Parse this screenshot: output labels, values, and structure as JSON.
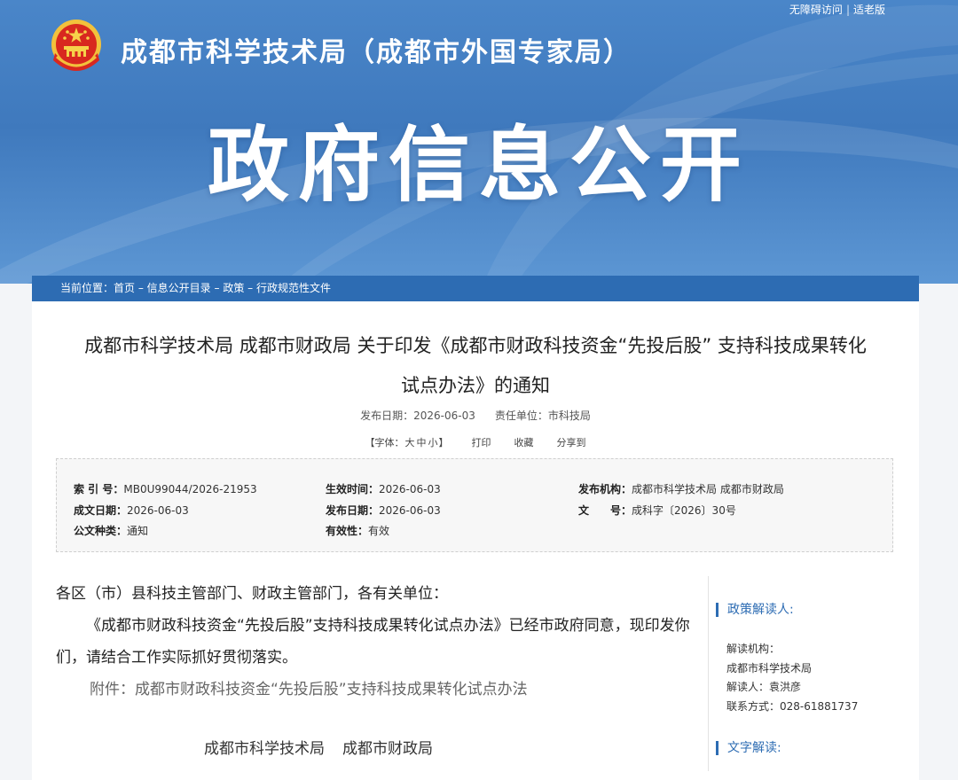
{
  "header": {
    "site_title": "成都市科学技术局（成都市外国专家局）",
    "hero_title": "政府信息公开",
    "top_links": [
      "无障碍访问",
      "适老版"
    ],
    "top_links_sep": "|"
  },
  "breadcrumb": {
    "prefix": "当前位置：",
    "items": [
      "首页",
      "信息公开目录",
      "政策",
      "行政规范性文件"
    ],
    "separator": " – "
  },
  "article": {
    "title_line1": "成都市科学技术局 成都市财政局 关于印发《成都市财政科技资金“先投后股” 支持科技成果转化",
    "title_line2": "试点办法》的通知",
    "publish_label": "发布日期：",
    "publish_date": "2026-06-03",
    "dept_label": "责任单位：",
    "dept": "市科技局"
  },
  "tools": {
    "font_label_open": "【字体：",
    "font_sizes": [
      "大",
      "中",
      "小"
    ],
    "font_label_close": "】",
    "print": "打印",
    "favorite": "收藏",
    "share": "分享到"
  },
  "info": {
    "index_label": "索 引 号：",
    "index_value": "MB0U99044/2026-21953",
    "effective_label": "生效时间：",
    "effective_value": "2026-06-03",
    "issuer_label": "发布机构：",
    "issuer_value": "成都市科学技术局 成都市财政局",
    "written_label": "成文日期：",
    "written_value": "2026-06-03",
    "publish_label": "发布日期：",
    "publish_value": "2026-06-03",
    "docno_label": "文　　号：",
    "docno_value": "成科字〔2026〕30号",
    "type_label": "公文种类：",
    "type_value": "通知",
    "validity_label": "有效性：",
    "validity_value": "有效"
  },
  "body": {
    "salutation": "各区（市）县科技主管部门、财政主管部门，各有关单位：",
    "paragraph": "《成都市财政科技资金“先投后股”支持科技成果转化试点办法》已经市政府同意，现印发你们，请结合工作实际抓好贯彻落实。",
    "attachment_label": "附件：",
    "attachment_link": "成都市财政科技资金“先投后股”支持科技成果转化试点办法",
    "signatories": [
      "成都市科学技术局",
      "成都市财政局"
    ]
  },
  "side": {
    "policy_interpreter_title": "政策解读人:",
    "org_label": "解读机构：",
    "org_value": "成都市科学技术局",
    "person_label": "解读人：",
    "person_value": "袁洪彦",
    "contact_label": "联系方式：",
    "contact_value": "028-61881737",
    "text_interp_title": "文字解读:"
  },
  "colors": {
    "banner": "#3f79bd",
    "breadcrumb_bar": "#2d6cb3",
    "accent": "#2d6cb3"
  }
}
